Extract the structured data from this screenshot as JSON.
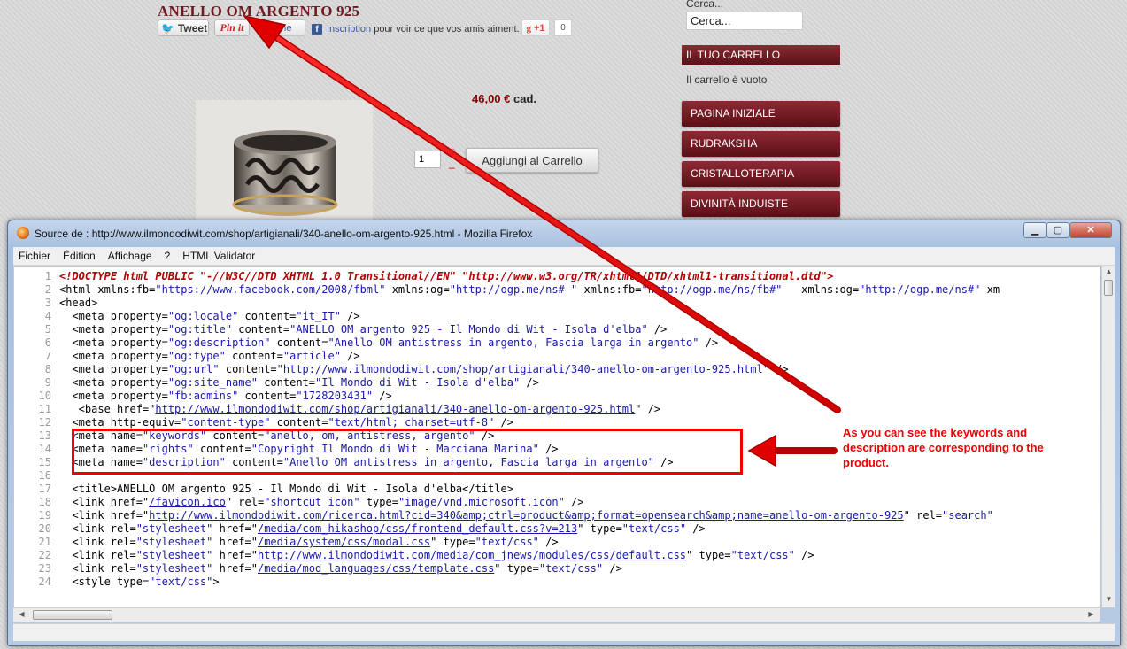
{
  "page": {
    "product_title": "ANELLO OM ARGENTO 925",
    "social": {
      "tweet_label": "Tweet",
      "pinit_label": "Pin it",
      "like_label": "J'aime",
      "fb_signup_link": "Inscription",
      "fb_signup_text": " pour voir ce que vos amis aiment.",
      "gplus_label": "+1",
      "gplus_count": "0"
    },
    "price": "46,00 €",
    "price_unit": "cad.",
    "quantity": "1",
    "qty_plus": "+",
    "qty_minus": "–",
    "add_to_cart_label": "Aggiungi al Carrello",
    "search_label": "Cerca...",
    "search_value": "Cerca...",
    "cart_header": "IL TUO CARRELLO",
    "cart_empty": "Il carrello è vuoto",
    "menu": [
      "PAGINA INIZIALE",
      "RUDRAKSHA",
      "CRISTALLOTERAPIA",
      "DIVINITÀ INDUISTE"
    ]
  },
  "firefox": {
    "title": "Source de : http://www.ilmondodiwit.com/shop/artigianali/340-anello-om-argento-925.html - Mozilla Firefox",
    "menu": [
      "Fichier",
      "Édition",
      "Affichage",
      "?",
      "HTML Validator"
    ],
    "icons": {
      "window": "firefox-icon",
      "min": "minimize-icon",
      "max": "maximize-icon",
      "close": "close-icon"
    },
    "lines": [
      "<!DOCTYPE html PUBLIC \"-//W3C//DTD XHTML 1.0 Transitional//EN\" \"http://www.w3.org/TR/xhtml1/DTD/xhtml1-transitional.dtd\">",
      "<html xmlns:fb=\"https://www.facebook.com/2008/fbml\" xmlns:og=\"http://ogp.me/ns# \" xmlns:fb=\"http://ogp.me/ns/fb#\"   xmlns:og=\"http://ogp.me/ns#\" xm",
      "<head>",
      "  <meta property=\"og:locale\" content=\"it_IT\" />",
      "  <meta property=\"og:title\" content=\"ANELLO OM argento 925 - Il Mondo di Wit - Isola d'elba\" />",
      "  <meta property=\"og:description\" content=\"Anello OM antistress in argento, Fascia larga in argento\" />",
      "  <meta property=\"og:type\" content=\"article\" />",
      "  <meta property=\"og:url\" content=\"http://www.ilmondodiwit.com/shop/artigianali/340-anello-om-argento-925.html\" />",
      "  <meta property=\"og:site_name\" content=\"Il Mondo di Wit - Isola d'elba\" />",
      "  <meta property=\"fb:admins\" content=\"1728203431\" />",
      "   <base href=\"http://www.ilmondodiwit.com/shop/artigianali/340-anello-om-argento-925.html\" />",
      "  <meta http-equiv=\"content-type\" content=\"text/html; charset=utf-8\" />",
      "  <meta name=\"keywords\" content=\"anello, om, antistress, argento\" />",
      "  <meta name=\"rights\" content=\"Copyright Il Mondo di Wit - Marciana Marina\" />",
      "  <meta name=\"description\" content=\"Anello OM antistress in argento, Fascia larga in argento\" />",
      "",
      "  <title>ANELLO OM argento 925 - Il Mondo di Wit - Isola d'elba</title>",
      "  <link href=\"/favicon.ico\" rel=\"shortcut icon\" type=\"image/vnd.microsoft.icon\" />",
      "  <link href=\"http://www.ilmondodiwit.com/ricerca.html?cid=340&amp;ctrl=product&amp;format=opensearch&amp;name=anello-om-argento-925\" rel=\"search\"",
      "  <link rel=\"stylesheet\" href=\"/media/com_hikashop/css/frontend_default.css?v=213\" type=\"text/css\" />",
      "  <link rel=\"stylesheet\" href=\"/media/system/css/modal.css\" type=\"text/css\" />",
      "  <link rel=\"stylesheet\" href=\"http://www.ilmondodiwit.com/media/com_jnews/modules/css/default.css\" type=\"text/css\" />",
      "  <link rel=\"stylesheet\" href=\"/media/mod_languages/css/template.css\" type=\"text/css\" />",
      "  <style type=\"text/css\">"
    ]
  },
  "annotation": {
    "callout": "As you can see the keywords and description are corresponding to the product.",
    "color": "#ee0000"
  }
}
